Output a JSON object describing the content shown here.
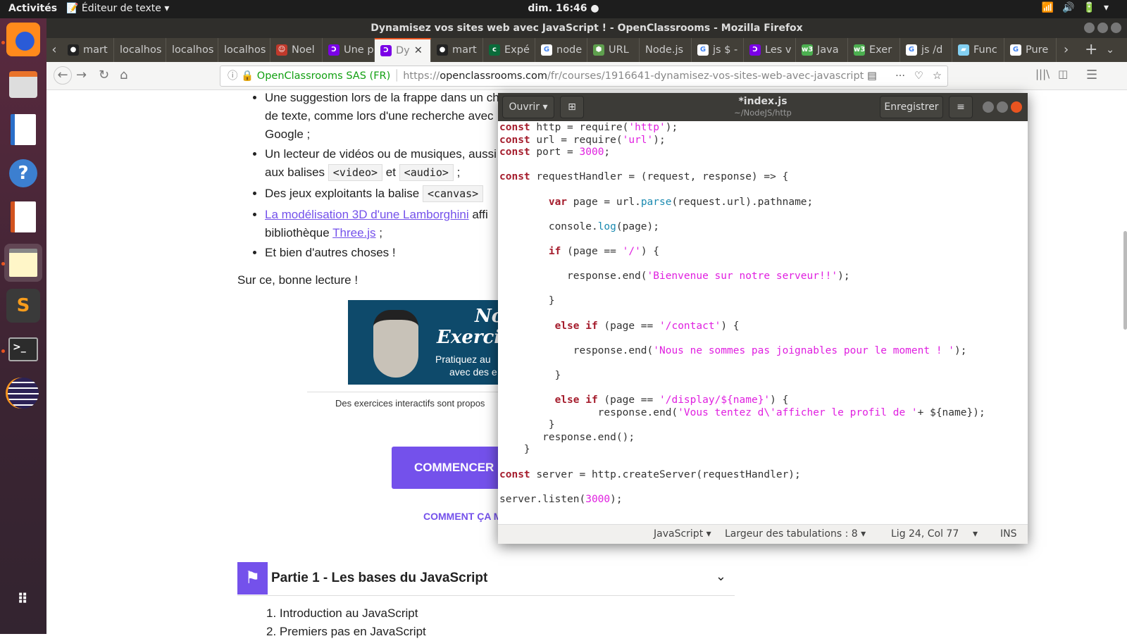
{
  "topbar": {
    "activities": "Activités",
    "app_menu": "📝 Éditeur de texte ▾",
    "clock": "dim. 16:46 ●",
    "tray": "📶🔊🔋▾"
  },
  "launcher": [
    "firefox-icon",
    "files-icon",
    "writer-icon",
    "help-icon",
    "impress-icon",
    "text-editor-icon",
    "sublime-icon",
    "terminal-icon",
    "eclipse-icon",
    "app-grid-icon"
  ],
  "firefox": {
    "title": "Dynamisez vos sites web avec JavaScript ! - OpenClassrooms - Mozilla Firefox",
    "tabs": [
      {
        "label": "mart",
        "icon": "github"
      },
      {
        "label": "localhos",
        "icon": ""
      },
      {
        "label": "localhos",
        "icon": ""
      },
      {
        "label": "localhos",
        "icon": ""
      },
      {
        "label": "Noel",
        "icon": "avatar"
      },
      {
        "label": "Une p",
        "icon": "openclassrooms"
      },
      {
        "label": "Dy",
        "icon": "openclassrooms",
        "selected": true
      },
      {
        "label": "mart",
        "icon": "github"
      },
      {
        "label": "Expé",
        "icon": "conc"
      },
      {
        "label": "node",
        "icon": "google"
      },
      {
        "label": "URL",
        "icon": "nodejs"
      },
      {
        "label": "Node.js",
        "icon": ""
      },
      {
        "label": "js $ -",
        "icon": "google"
      },
      {
        "label": "Les v",
        "icon": "openclassrooms"
      },
      {
        "label": "Java",
        "icon": "w3"
      },
      {
        "label": "Exer",
        "icon": "w3"
      },
      {
        "label": "js /d",
        "icon": "google"
      },
      {
        "label": "Func",
        "icon": "mdn"
      },
      {
        "label": "Pure",
        "icon": "google"
      }
    ],
    "identity": "OpenClassrooms SAS (FR)",
    "url_prefix": "https://",
    "url_host": "openclassrooms.com",
    "url_path": "/fr/courses/1916641-dynamisez-vos-sites-web-avec-javascript"
  },
  "page": {
    "bullets": {
      "b1": "Une suggestion lors de la frappe dans un champ de texte, comme lors d'une recherche avec Google ;",
      "b2a": "Un lecteur de vidéos ou de musiques, aussi",
      "b2b": "aux balises",
      "video": "<video>",
      "et": "et",
      "audio": "<audio>",
      "semi": ";",
      "b3a": "Des jeux exploitants la balise",
      "canvas": "<canvas>",
      "b4link": "La modélisation 3D d'une Lamborghini",
      "b4a": "affi",
      "b4b": "bibliothèque",
      "threejs": "Three.js",
      "b4c": ";",
      "b5": "Et bien d'autres choses !"
    },
    "outro": "Sur ce, bonne lecture !",
    "banner": {
      "t1": "No",
      "t2": "Exercice",
      "t3": "Pratiquez au",
      "t4": "avec des e"
    },
    "caption": "Des exercices interactifs sont propos",
    "start_button": "COMMENCER",
    "how_link": "COMMENT ÇA M",
    "part": {
      "title": "Partie 1 - Les bases du JavaScript",
      "chapters": [
        "1. Introduction au JavaScript",
        "2. Premiers pas en JavaScript"
      ]
    }
  },
  "editor": {
    "open": "Ouvrir ▾",
    "title": "*index.js",
    "subtitle": "~/NodeJS/http",
    "save": "Enregistrer",
    "code": [
      "const http = require('http');",
      "const url = require('url');",
      "const port = 3000;",
      "",
      "const requestHandler = (request, response) => {",
      "",
      "        var page = url.parse(request.url).pathname;",
      "",
      "        console.log(page);",
      "",
      "        if (page == '/') {",
      "",
      "           response.end('Bienvenue sur notre serveur!!');",
      "",
      "        }",
      "",
      "         else if (page == '/contact') {",
      "",
      "            response.end('Nous ne sommes pas joignables pour le moment ! ');",
      "",
      "         }",
      "",
      "         else if (page == '/display/${name}') {",
      "                response.end('Vous tentez d\\'afficher le profil de '+ ${name});",
      "        }",
      "       response.end();",
      "    }",
      "",
      "const server = http.createServer(requestHandler);",
      "",
      "server.listen(3000);"
    ],
    "status": {
      "language": "JavaScript ▾",
      "tabs": "Largeur des tabulations : 8 ▾",
      "position": "Lig 24, Col 77",
      "pos_menu": "▾",
      "mode": "INS"
    }
  },
  "colors": {
    "accent": "#7451eb",
    "ubuntu_orange": "#e95420",
    "keyword": "#a51d2d",
    "string": "#e020e0"
  }
}
